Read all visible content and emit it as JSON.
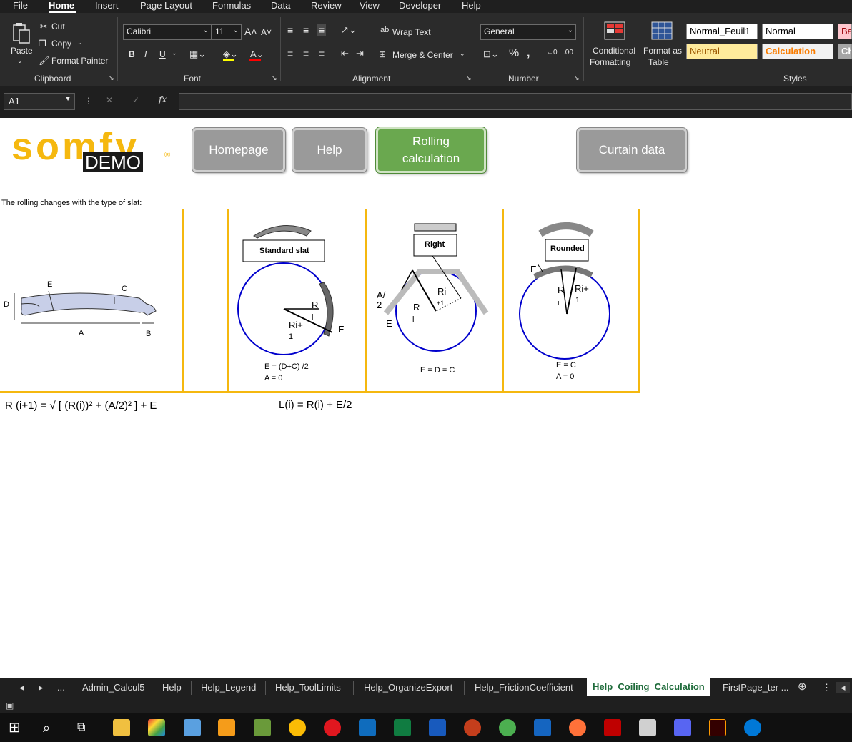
{
  "menu": {
    "items": [
      "File",
      "Home",
      "Insert",
      "Page Layout",
      "Formulas",
      "Data",
      "Review",
      "View",
      "Developer",
      "Help"
    ]
  },
  "ribbon": {
    "clipboard": {
      "paste": "Paste",
      "cut": "Cut",
      "copy": "Copy",
      "format_painter": "Format Painter",
      "label": "Clipboard"
    },
    "font": {
      "name": "Calibri",
      "size": "11",
      "bold": "B",
      "italic": "I",
      "underline": "U",
      "label": "Font"
    },
    "alignment": {
      "wrap_text": "Wrap Text",
      "merge_center": "Merge & Center",
      "label": "Alignment"
    },
    "number": {
      "format": "General",
      "label": "Number"
    },
    "styles": {
      "conditional_formatting_1": "Conditional",
      "conditional_formatting_2": "Formatting",
      "format_as_table_1": "Format as",
      "format_as_table_2": "Table",
      "normal_feuil1": "Normal_Feuil1",
      "normal": "Normal",
      "bad": "Ba",
      "neutral": "Neutral",
      "calculation": "Calculation",
      "check": "Ch",
      "label": "Styles"
    }
  },
  "formula_bar": {
    "name_box": "A1",
    "fx": "fx",
    "content": ""
  },
  "sheet": {
    "logo_text": "somfy",
    "logo_demo": "DEMO",
    "buttons": {
      "homepage": "Homepage",
      "help": "Help",
      "rolling_1": "Rolling",
      "rolling_2": "calculation",
      "curtain": "Curtain data"
    },
    "intro": "The rolling changes with the type of slat:",
    "slat_labels": {
      "e": "E",
      "c": "C",
      "d": "D",
      "a": "A",
      "b": "B"
    },
    "standard": {
      "title": "Standard slat",
      "r": "R",
      "i": "i",
      "ri1": "Ri+",
      "one": "1",
      "e": "E",
      "formula1": "E = (D+C) /2",
      "formula2": "A = 0"
    },
    "right": {
      "title": "Right",
      "ri": "Ri",
      "plus1": "+1",
      "r": "R",
      "i": "i",
      "a2_1": "A/",
      "a2_2": "2",
      "e": "E",
      "formula": "E = D = C"
    },
    "rounded": {
      "title": "Rounded",
      "e": "E",
      "r": "R",
      "i": "i",
      "ri1": "Ri+",
      "one": "1",
      "formula1": "E = C",
      "formula2": "A = 0"
    },
    "formula_left": "R (i+1) = √ [ (R(i))² + (A/2)² ]  +  E",
    "formula_right": "L(i) = R(i) + E/2"
  },
  "tabs": {
    "nav_more": "...",
    "items": [
      "Admin_Calcul5",
      "Help",
      "Help_Legend",
      "Help_ToolLimits",
      "Help_OrganizeExport",
      "Help_FrictionCoefficient",
      "Help_Coiling_Calculation",
      "FirstPage_ter ..."
    ],
    "active": "Help_Coiling_Calculation"
  },
  "colors": {
    "accent_yellow": "#f5b80f",
    "button_gray": "#9a9a9a",
    "button_green": "#6aa84f",
    "circle_blue": "#0000cc",
    "logo_orange": "#f5b80f"
  }
}
